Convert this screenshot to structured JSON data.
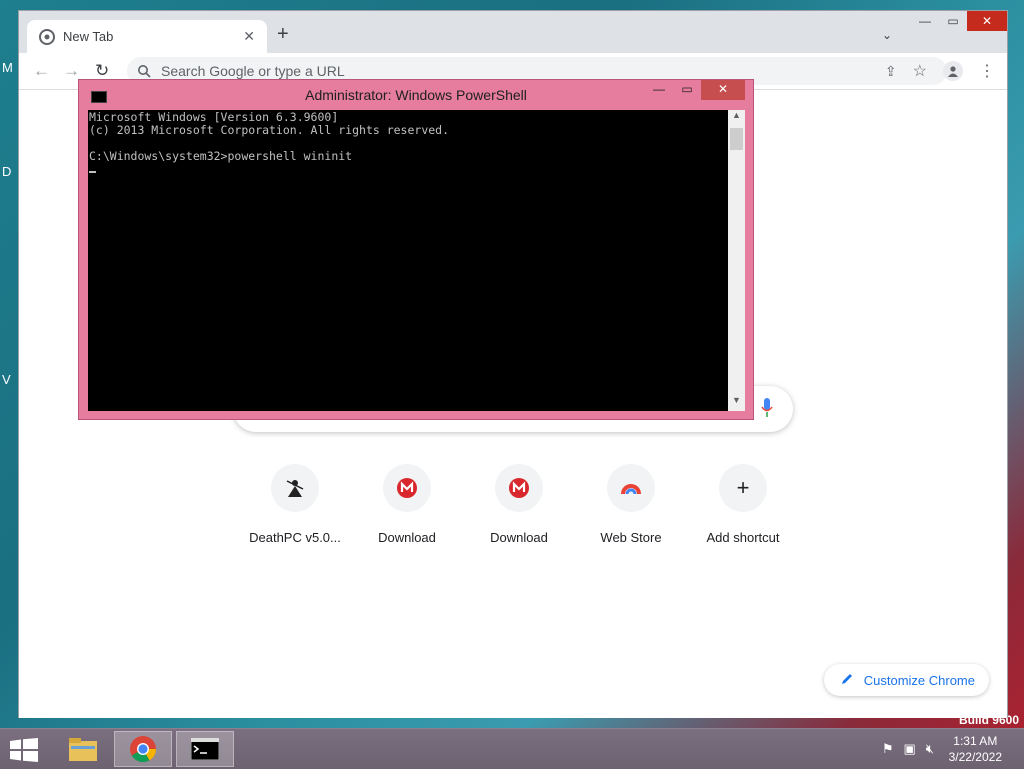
{
  "desktop": {
    "watermark": "Build 9600"
  },
  "browser": {
    "tab_title": "New Tab",
    "omnibox_placeholder": "Search Google or type a URL",
    "shortcuts": [
      {
        "label": "DeathPC v5.0...",
        "icon": "deathpc-icon"
      },
      {
        "label": "Download",
        "icon": "mega-icon"
      },
      {
        "label": "Download",
        "icon": "mega-icon"
      },
      {
        "label": "Web Store",
        "icon": "web-store-icon"
      },
      {
        "label": "Add shortcut",
        "icon": "plus-icon"
      }
    ],
    "customize_label": "Customize Chrome"
  },
  "powershell": {
    "title": "Administrator: Windows PowerShell",
    "lines": [
      "Microsoft Windows [Version 6.3.9600]",
      "(c) 2013 Microsoft Corporation. All rights reserved.",
      "",
      "C:\\Windows\\system32>powershell wininit"
    ]
  },
  "taskbar": {
    "time": "1:31 AM",
    "date": "3/22/2022"
  },
  "colors": {
    "ps_frame": "#e67d9f",
    "accent": "#1a73e8",
    "mega_red": "#d9272e"
  }
}
